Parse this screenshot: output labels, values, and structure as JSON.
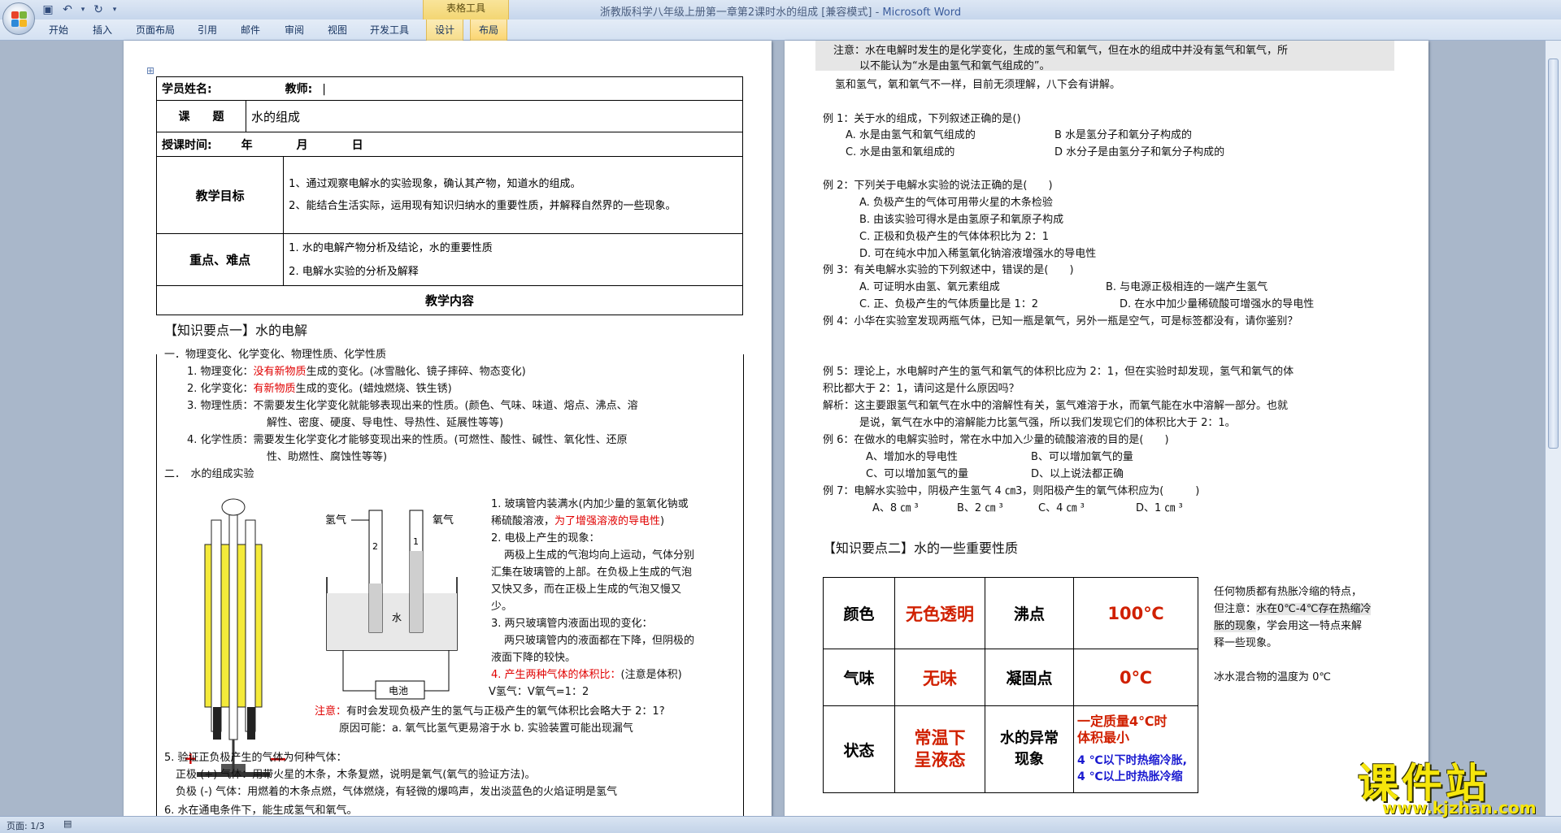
{
  "window": {
    "title": "浙教版科学八年级上册第一章第2课时水的组成 [兼容模式]",
    "app_name": "Microsoft Word",
    "title_separator": " - ",
    "context_group": "表格工具"
  },
  "ribbon": {
    "tabs": [
      "开始",
      "插入",
      "页面布局",
      "引用",
      "邮件",
      "审阅",
      "视图",
      "开发工具",
      "设计",
      "布局"
    ]
  },
  "status": {
    "page": "页面: 1/3"
  },
  "page1": {
    "table": {
      "student_label": "学员姓名:",
      "teacher_label": "教师:",
      "topic_label": "课　　题",
      "topic_value": "水的组成",
      "time_label": "授课时间:",
      "year": "年",
      "month": "月",
      "day": "日",
      "goals_label": "教学目标",
      "goal1": "1、通过观察电解水的实验现象，确认其产物，知道水的组成。",
      "goal2": "2、能结合生活实际，运用现有知识归纳水的重要性质，并解释自然界的一些现象。",
      "key_label": "重点、难点",
      "key1": "1. 水的电解产物分析及结论，水的重要性质",
      "key2": "2. 电解水实验的分析及解释",
      "content_label": "教学内容"
    },
    "section1_title": "【知识要点一】水的电解",
    "s1_line1": "一．物理变化、化学变化、物理性质、化学性质",
    "s1_phys_change_a": "1. 物理变化：",
    "s1_phys_change_red": "没有新物质",
    "s1_phys_change_b": "生成的变化。(冰雪融化、镜子摔碎、物态变化)",
    "s1_chem_change_a": "2. 化学变化：",
    "s1_chem_change_red": "有新物质",
    "s1_chem_change_b": "生成的变化。(蜡烛燃烧、铁生锈)",
    "s1_phys_prop_a": "3. 物理性质：不需要发生化学变化就能够表现出来的性质。(颜色、气味、味道、熔点、沸点、溶",
    "s1_phys_prop_b": "解性、密度、硬度、导电性、导热性、延展性等等)",
    "s1_chem_prop_a": "4. 化学性质：需要发生化学变化才能够变现出来的性质。(可燃性、酸性、碱性、氧化性、还原",
    "s1_chem_prop_b": "性、助燃性、腐蚀性等等)",
    "s1_exp_title": "二．　水的组成实验",
    "diagram": {
      "h2": "氢气",
      "o2": "氧气",
      "water": "水",
      "battery": "电池",
      "plus": "+",
      "minus": "—",
      "v2": "2",
      "v1": "1"
    },
    "exp1a": "1. 玻璃管内装满水(内加少量的氢氧化钠或",
    "exp1b_a": "稀硫酸溶液，",
    "exp1b_red": "为了增强溶液的导电性",
    "exp1b_b": ")",
    "exp2_red": "2. 电极上产生的现象：",
    "exp2a": "两极上生成的气泡均向上运动，气体分别",
    "exp2b": "汇集在玻璃管的上部。在负极上生成的气泡",
    "exp2c": "又快又多，而在正极上生成的气泡又慢又",
    "exp2d": "少。",
    "exp3_red": "3. 两只玻璃管内液面出现的变化：",
    "exp3a": "两只玻璃管内的液面都在下降，但阴极的",
    "exp3b": "液面下降的较快。",
    "exp4_red": "4. 产生两种气体的体积比：",
    "exp4_tail": "(注意是体积)",
    "exp4_ratio": "V氢气：V氧气=1：2",
    "note_red": "注意：",
    "note_a": "有时会发现负极产生的氢气与正极产生的氧气体积比会略大于 2：1?",
    "note_b": "原因可能：a. 氧气比氢气更易溶于水 b. 实验装置可能出现漏气",
    "s5_red": "5. 验证正负极产生的气体为何种气体：",
    "s5_pos": "正极 (+) 气体：用带火星的木条，木条复燃，说明是氧气(氧气的验证方法)。",
    "s5_neg": "负极 (-) 气体：用燃着的木条点燃，气体燃烧，有轻微的爆鸣声，发出淡蓝色的火焰证明是氢气",
    "s6_partial": "6. 水在通电条件下，能生成氢气和氧气。"
  },
  "page2": {
    "note1a": "注意：水在电解时发生的是化学变化，生成的氢气和氧气，但在水的组成中并没有氢气和氧气，所",
    "note1b": "以不能认为“水是由氢气和氧气组成的”。",
    "note2": "氢和氢气，氧和氧气不一样，目前无须理解，八下会有讲解。",
    "ex1": "例 1：关于水的组成，下列叙述正确的是()",
    "ex1A": "A. 水是由氢气和氧气组成的",
    "ex1B": "B 水是氢分子和氧分子构成的",
    "ex1C": "C. 水是由氢和氧组成的",
    "ex1D": "D 水分子是由氢分子和氧分子构成的",
    "ex2": "例 2：下列关于电解水实验的说法正确的是(　　)",
    "ex2A": "A. 负极产生的气体可用带火星的木条检验",
    "ex2B": "B. 由该实验可得水是由氢原子和氧原子构成",
    "ex2C": "C. 正极和负极产生的气体体积比为 2：1",
    "ex2D": "D. 可在纯水中加入稀氢氧化钠溶液增强水的导电性",
    "ex3": "例 3：有关电解水实验的下列叙述中，错误的是(　　)",
    "ex3A": "A. 可证明水由氢、氧元素组成",
    "ex3B": "B. 与电源正极相连的一端产生氢气",
    "ex3C": "C. 正、负极产生的气体质量比是 1：2",
    "ex3D": "D. 在水中加少量稀硫酸可增强水的导电性",
    "ex4": "例 4：小华在实验室发现两瓶气体，已知一瓶是氧气，另外一瓶是空气，可是标签都没有，请你鉴别？",
    "ex5a": "例 5：理论上，水电解时产生的氢气和氧气的体积比应为 2：1，但在实验时却发现，氢气和氧气的体",
    "ex5b": "积比都大于 2：1，请问这是什么原因吗？",
    "ex5c": "解析：这主要跟氢气和氧气在水中的溶解性有关，氢气难溶于水，而氧气能在水中溶解一部分。也就",
    "ex5d": "是说，氧气在水中的溶解能力比氢气强，所以我们发现它们的体积比大于 2：1。",
    "ex6": "例 6：在做水的电解实验时，常在水中加入少量的硫酸溶液的目的是(　　)",
    "ex6A": "A、增加水的导电性",
    "ex6B": "B、可以增加氧气的量",
    "ex6C": "C、可以增加氢气的量",
    "ex6D": "D、以上说法都正确",
    "ex7": "例 7：电解水实验中，阴极产生氢气 4 ㎝3，则阳极产生的氧气体积应为(　　　)",
    "ex7A": "A、8 ㎝ ³",
    "ex7B": "B、2 ㎝ ³",
    "ex7C": "C、4 ㎝ ³",
    "ex7D": "D、1 ㎝ ³",
    "section2_title": "【知识要点二】水的一些重要性质",
    "grid": {
      "color_label": "颜色",
      "color_value": "无色透明",
      "boil_label": "沸点",
      "boil_value": "100℃",
      "smell_label": "气味",
      "smell_value": "无味",
      "freeze_label": "凝固点",
      "freeze_value": "0℃",
      "state_label": "状态",
      "state_value_1": "常温下",
      "state_value_2": "呈液态",
      "anomaly_label_1": "水的异常",
      "anomaly_label_2": "现象",
      "anomaly_1": "一定质量4℃时",
      "anomaly_2": "体积最小",
      "anomaly_3": "4 ℃以下时热缩冷胀,",
      "anomaly_4": "4 ℃以上时热胀冷缩"
    },
    "side1": "任何物质都有热胀冷缩的特点，",
    "side2a": "但注意：",
    "side2b": "水在0℃-4℃存在热缩冷",
    "side3a": "胀的现象",
    "side3b": "，学会用这一特点来解",
    "side4": "释一些现象。",
    "side5": "冰水混合物的温度为 0℃"
  },
  "watermark": {
    "cn": "课件站",
    "url": "www.kjzhan.com"
  },
  "colors": {
    "red": "#e00000",
    "grid_red": "#d02000",
    "blue": "#1a1ad0"
  }
}
